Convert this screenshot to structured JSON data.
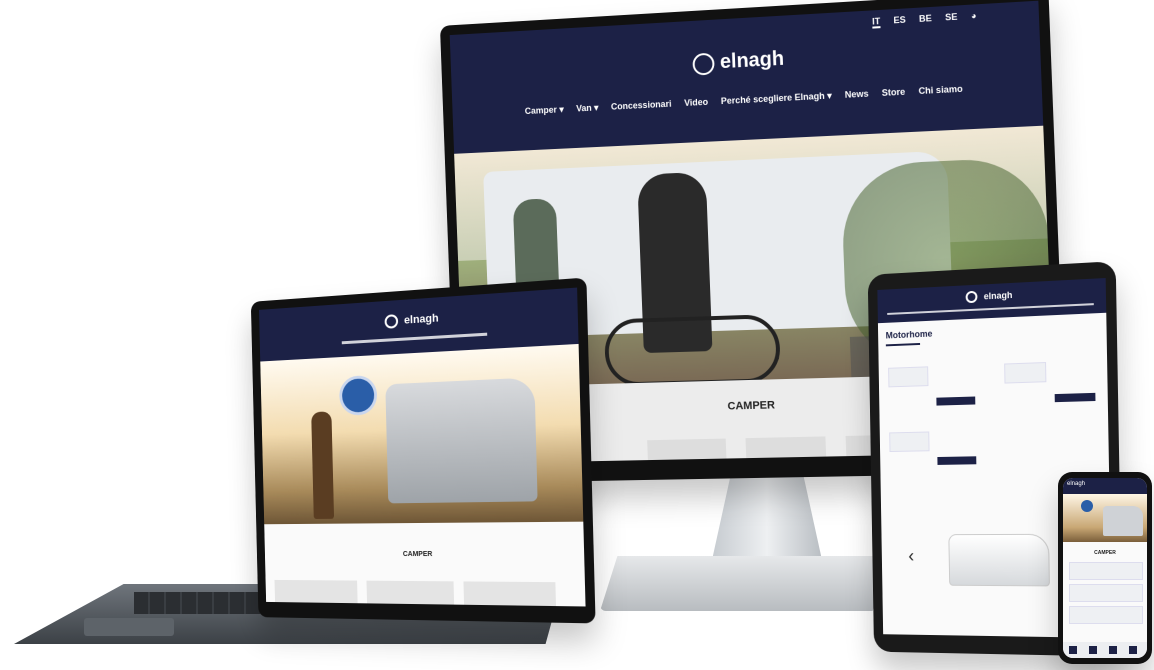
{
  "brand": {
    "name": "elnagh"
  },
  "desktop": {
    "languages": [
      "IT",
      "ES",
      "BE",
      "SE"
    ],
    "menu": [
      {
        "label": "Camper",
        "has_dropdown": true
      },
      {
        "label": "Van",
        "has_dropdown": true
      },
      {
        "label": "Concessionari",
        "has_dropdown": false
      },
      {
        "label": "Video",
        "has_dropdown": false
      },
      {
        "label": "Perché scegliere Elnagh",
        "has_dropdown": true
      },
      {
        "label": "News",
        "has_dropdown": false
      },
      {
        "label": "Store",
        "has_dropdown": false
      },
      {
        "label": "Chi siamo",
        "has_dropdown": false
      }
    ],
    "section_title": "CAMPER",
    "dropdown_glyph": "▾",
    "globe_icon": "globe-icon"
  },
  "laptop": {
    "section_title": "CAMPER"
  },
  "tablet": {
    "page_title": "Motorhome"
  },
  "phone": {
    "section_title": "CAMPER"
  },
  "colors": {
    "navy": "#1c2146",
    "white": "#ffffff"
  }
}
